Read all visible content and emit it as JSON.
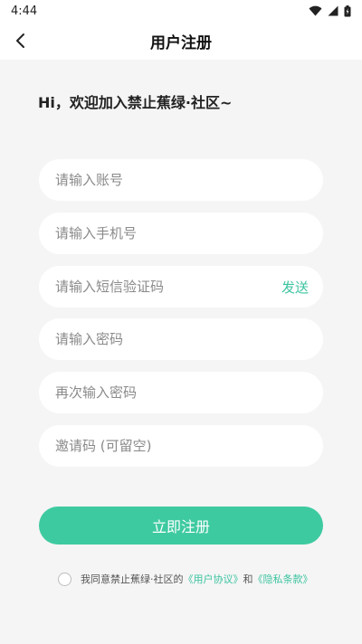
{
  "status_bar": {
    "time": "4:44"
  },
  "header": {
    "title": "用户注册"
  },
  "greeting": "Hi，欢迎加入禁止蕉绿·社区~",
  "form": {
    "account_placeholder": "请输入账号",
    "phone_placeholder": "请输入手机号",
    "sms_code_placeholder": "请输入短信验证码",
    "send_label": "发送",
    "password_placeholder": "请输入密码",
    "confirm_password_placeholder": "再次输入密码",
    "invite_placeholder": "邀请码 (可留空)",
    "submit_label": "立即注册"
  },
  "agreement": {
    "prefix": "我同意禁止蕉绿·社区的",
    "user_agreement": "《用户协议》",
    "and": "和",
    "privacy_policy": "《隐私条款》"
  },
  "colors": {
    "accent": "#3ecaa0",
    "background": "#f5f5f5"
  },
  "icons": [
    "back-arrow-icon",
    "wifi-icon",
    "signal-icon",
    "battery-icon"
  ]
}
